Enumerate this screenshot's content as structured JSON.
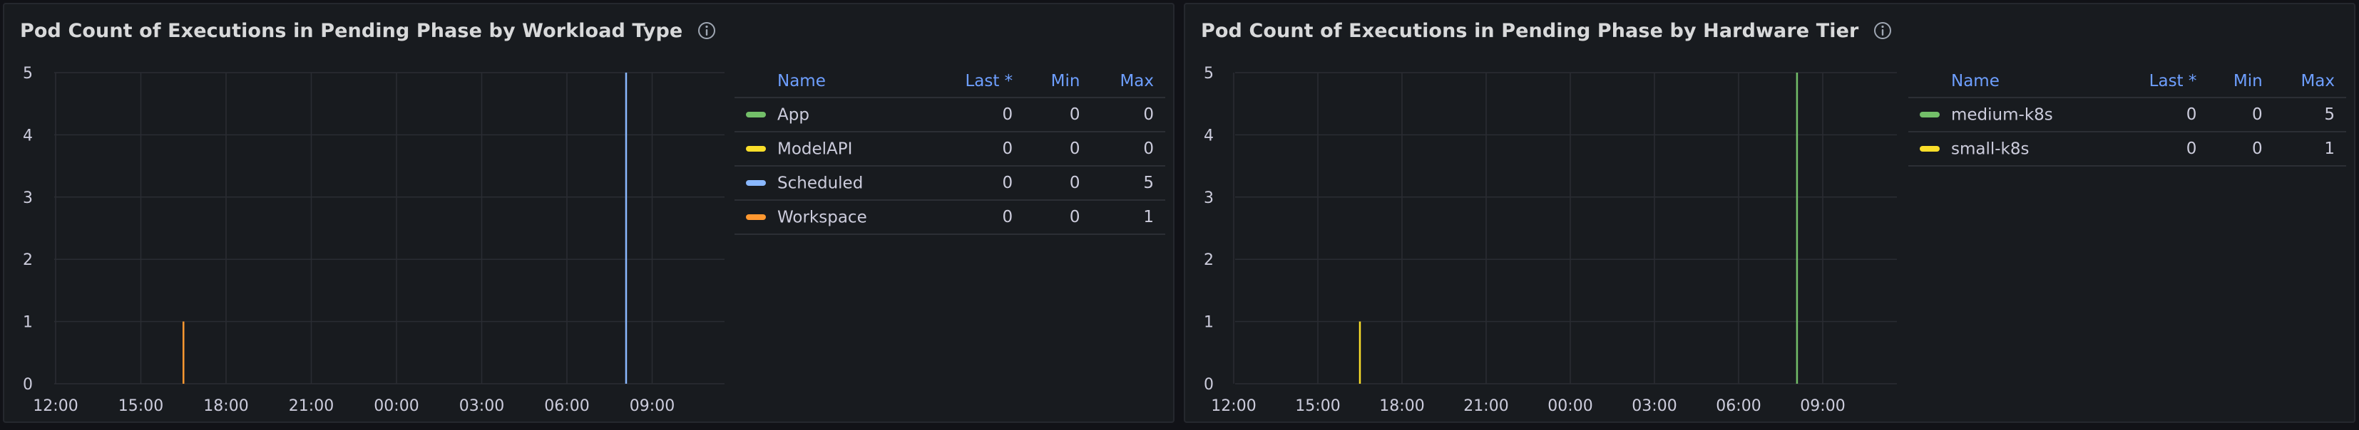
{
  "panels": [
    {
      "title": "Pod Count of Executions in Pending Phase by Workload Type",
      "legend": {
        "headers": [
          "Name",
          "Last *",
          "Min",
          "Max"
        ],
        "rows": [
          {
            "name": "App",
            "color": "#73bf69",
            "last": "0",
            "min": "0",
            "max": "0"
          },
          {
            "name": "ModelAPI",
            "color": "#fade2a",
            "last": "0",
            "min": "0",
            "max": "0"
          },
          {
            "name": "Scheduled",
            "color": "#8ab8ff",
            "last": "0",
            "min": "0",
            "max": "5"
          },
          {
            "name": "Workspace",
            "color": "#ff9830",
            "last": "0",
            "min": "0",
            "max": "1"
          }
        ]
      }
    },
    {
      "title": "Pod Count of Executions in Pending Phase by Hardware Tier",
      "legend": {
        "headers": [
          "Name",
          "Last *",
          "Min",
          "Max"
        ],
        "rows": [
          {
            "name": "medium-k8s",
            "color": "#73bf69",
            "last": "0",
            "min": "0",
            "max": "5"
          },
          {
            "name": "small-k8s",
            "color": "#fade2a",
            "last": "0",
            "min": "0",
            "max": "1"
          }
        ]
      }
    }
  ],
  "chart_data": [
    {
      "type": "line",
      "title": "Pod Count of Executions in Pending Phase by Workload Type",
      "x_ticks": [
        "12:00",
        "15:00",
        "18:00",
        "21:00",
        "00:00",
        "03:00",
        "06:00",
        "09:00"
      ],
      "y_ticks": [
        0,
        1,
        2,
        3,
        4,
        5
      ],
      "ylim": [
        0,
        5
      ],
      "grid": true,
      "legend_placement": "right",
      "spikes": [
        {
          "series": "Workspace",
          "color": "#ff9830",
          "x": "16:30",
          "value": 1
        },
        {
          "series": "Scheduled",
          "color": "#8ab8ff",
          "x": "08:05",
          "value": 5
        }
      ]
    },
    {
      "type": "line",
      "title": "Pod Count of Executions in Pending Phase by Hardware Tier",
      "x_ticks": [
        "12:00",
        "15:00",
        "18:00",
        "21:00",
        "00:00",
        "03:00",
        "06:00",
        "09:00"
      ],
      "y_ticks": [
        0,
        1,
        2,
        3,
        4,
        5
      ],
      "ylim": [
        0,
        5
      ],
      "grid": true,
      "legend_placement": "right",
      "spikes": [
        {
          "series": "small-k8s",
          "color": "#fade2a",
          "x": "16:30",
          "value": 1
        },
        {
          "series": "medium-k8s",
          "color": "#73bf69",
          "x": "08:05",
          "value": 5
        }
      ]
    }
  ]
}
